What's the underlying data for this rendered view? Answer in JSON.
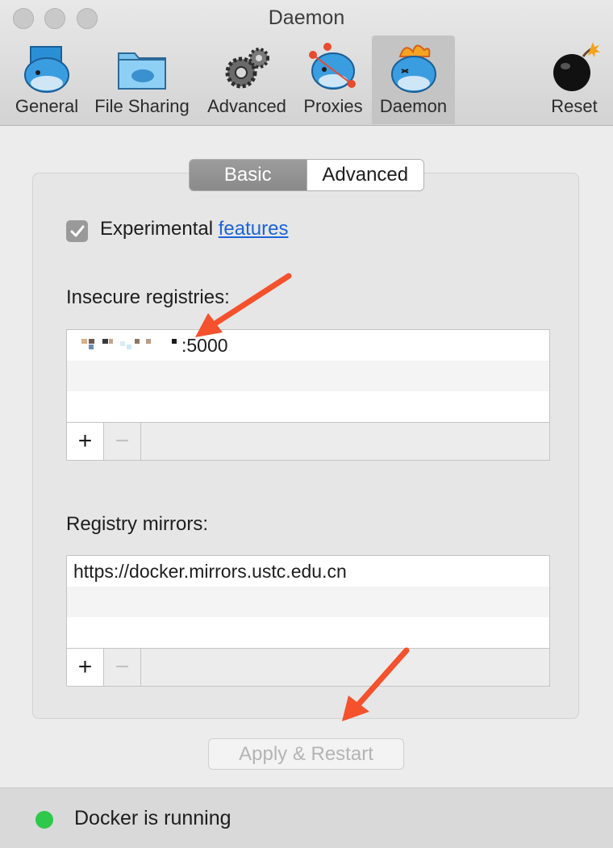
{
  "window": {
    "title": "Daemon"
  },
  "toolbar": {
    "items": [
      {
        "label": "General"
      },
      {
        "label": "File Sharing"
      },
      {
        "label": "Advanced"
      },
      {
        "label": "Proxies"
      },
      {
        "label": "Daemon"
      },
      {
        "label": "Reset"
      }
    ],
    "selected": "Daemon"
  },
  "tabs": {
    "basic": "Basic",
    "advanced": "Advanced",
    "active": "Basic"
  },
  "experimental": {
    "label": "Experimental",
    "link": "features",
    "checked": true
  },
  "insecure_registries": {
    "label": "Insecure registries:",
    "entries": [
      ":5000"
    ]
  },
  "registry_mirrors": {
    "label": "Registry mirrors:",
    "entries": [
      "https://docker.mirrors.ustc.edu.cn"
    ]
  },
  "list_controls": {
    "add": "+",
    "remove": "−"
  },
  "apply_button": {
    "label": "Apply & Restart",
    "enabled": false
  },
  "status": {
    "text": "Docker is running",
    "color": "#2ec84a"
  },
  "colors": {
    "link": "#1a64d8",
    "arrow": "#f4512c",
    "selected_tab": "#8f8f8f"
  }
}
